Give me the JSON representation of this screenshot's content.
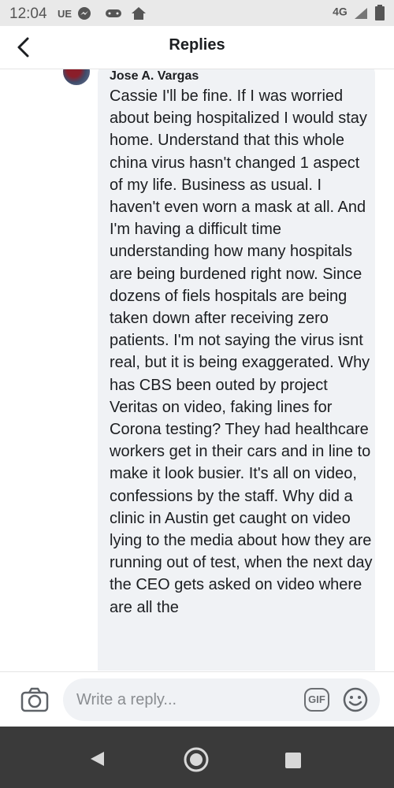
{
  "status_bar": {
    "time": "12:04",
    "carrier": "UE",
    "network": "4G",
    "icons": [
      "messenger-icon",
      "game-controller-icon",
      "home-icon",
      "network-4g-icon",
      "signal-icon",
      "battery-icon"
    ]
  },
  "header": {
    "title": "Replies",
    "back_icon": "chevron-left-icon"
  },
  "comment": {
    "author": "Jose A. Vargas",
    "text": "Cassie I'll be fine. If I was worried about being hospitalized I would stay home. Understand that this whole china virus hasn't changed 1 aspect of my life.  Business as usual. I haven't even worn a mask at all. And I'm having a difficult time understanding how many hospitals are being burdened right now. Since dozens of fiels hospitals are being taken down after receiving zero patients. I'm not saying the virus isnt real, but it is being exaggerated. Why has CBS been outed by project Veritas on video, faking lines for Corona testing? They had healthcare workers get in their cars and in line to make it look busier. It's all on video, confessions by the staff. Why did a clinic in Austin get caught on video lying to the media about how they are running out of test, when the next day the CEO gets asked on video where are all the"
  },
  "composer": {
    "placeholder": "Write a reply...",
    "gif_label": "GIF",
    "camera_icon": "camera-icon",
    "emoji_icon": "smiley-icon"
  },
  "nav_bar": {
    "icons": [
      "back-triangle-icon",
      "home-circle-icon",
      "recent-apps-square-icon"
    ]
  },
  "colors": {
    "bubble": "#f0f2f5",
    "text": "#1c1e21",
    "navbar": "#3a3a3a",
    "statusbar": "#e9e9e9"
  }
}
